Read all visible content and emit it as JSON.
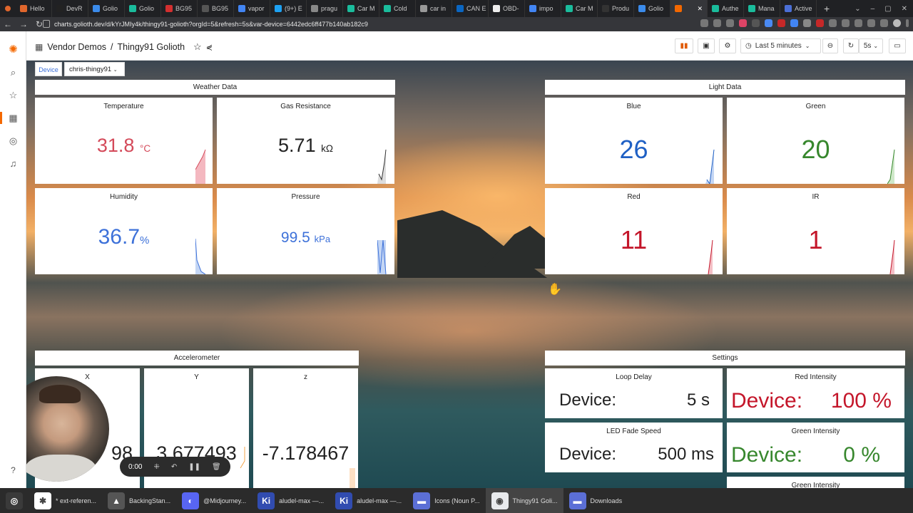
{
  "browser": {
    "tabs": [
      {
        "label": "Hello",
        "color": "#e0662c"
      },
      {
        "label": "DevR",
        "color": "#222"
      },
      {
        "label": "Golio",
        "color": "#3b8beb"
      },
      {
        "label": "Golio",
        "color": "#1abc9c"
      },
      {
        "label": "BG95",
        "color": "#d32f2f"
      },
      {
        "label": "BG95",
        "color": "#555"
      },
      {
        "label": "vapor",
        "color": "#4285f4"
      },
      {
        "label": "(9+) E",
        "color": "#1da1f2"
      },
      {
        "label": "pragu",
        "color": "#888"
      },
      {
        "label": "Car M",
        "color": "#1abc9c"
      },
      {
        "label": "Cold",
        "color": "#1abc9c"
      },
      {
        "label": "car in",
        "color": "#999"
      },
      {
        "label": "CAN E",
        "color": "#0a66c2"
      },
      {
        "label": "OBD-",
        "color": "#eee"
      },
      {
        "label": "impo",
        "color": "#4285f4"
      },
      {
        "label": "Car M",
        "color": "#1abc9c"
      },
      {
        "label": "Produ",
        "color": "#333"
      },
      {
        "label": "Golio",
        "color": "#3b8beb"
      },
      {
        "label": "",
        "color": "#f46800"
      },
      {
        "label": "Authe",
        "color": "#1abc9c"
      },
      {
        "label": "Mana",
        "color": "#1abc9c"
      },
      {
        "label": "Active",
        "color": "#4b6fd6"
      }
    ],
    "url": "charts.golioth.dev/d/kYrJMIy4k/thingy91-golioth?orgId=5&refresh=5s&var-device=6442edc6ff477b140ab182c9"
  },
  "header": {
    "folder": "Vendor Demos",
    "separator": "/",
    "title": "Thingy91 Golioth",
    "time_range": "Last 5 minutes",
    "refresh": "5s"
  },
  "variables": {
    "device_label": "Device",
    "device_value": "chris-thingy91"
  },
  "rows": {
    "weather": "Weather Data",
    "light": "Light Data",
    "accel": "Accelerometer",
    "settings": "Settings"
  },
  "weather": {
    "temperature": {
      "title": "Temperature",
      "value": "31.8",
      "unit": "°C",
      "color": "#d44a5a"
    },
    "gas": {
      "title": "Gas Resistance",
      "value": "5.71",
      "unit": "kΩ",
      "color": "#222"
    },
    "humidity": {
      "title": "Humidity",
      "value": "36.7",
      "unit": "%",
      "color": "#3d71d9"
    },
    "pressure": {
      "title": "Pressure",
      "value": "99.5",
      "unit": "kPa",
      "color": "#3d71d9"
    }
  },
  "light": {
    "blue": {
      "title": "Blue",
      "value": "26",
      "color": "#1f60c4"
    },
    "green": {
      "title": "Green",
      "value": "20",
      "color": "#37872d"
    },
    "red": {
      "title": "Red",
      "value": "11",
      "color": "#c4162a"
    },
    "ir": {
      "title": "IR",
      "value": "1",
      "color": "#c4162a"
    }
  },
  "accel": {
    "x": {
      "title": "X",
      "value": "98"
    },
    "y": {
      "title": "Y",
      "value": "3.677493"
    },
    "z": {
      "title": "z",
      "value": "-7.178467"
    }
  },
  "settings": {
    "loop_delay": {
      "title": "Loop Delay",
      "label": "Device:",
      "value": "5 s",
      "color": "#222"
    },
    "red_intensity": {
      "title": "Red Intensity",
      "label": "Device:",
      "value": "100 %",
      "color": "#c4162a"
    },
    "led_fade": {
      "title": "LED Fade Speed",
      "label": "Device:",
      "value": "500 ms",
      "color": "#222"
    },
    "green_intensity": {
      "title": "Green Intensity",
      "label": "Device:",
      "value": "0 %",
      "color": "#37872d"
    },
    "green_intensity_2": {
      "title": "Green Intensity"
    }
  },
  "recorder": {
    "time": "0:00"
  },
  "taskbar": [
    {
      "label": "",
      "icon": "linux-mint-icon",
      "color": "#3a3a3a",
      "glyph": "◎"
    },
    {
      "label": "* ext-referen...",
      "icon": "slack-icon",
      "color": "#ffffff",
      "glyph": "✱"
    },
    {
      "label": "BackingStan...",
      "icon": "inkscape-icon",
      "color": "#555",
      "glyph": "▲"
    },
    {
      "label": "@Midjourney...",
      "icon": "discord-icon",
      "color": "#5865f2",
      "glyph": "◐"
    },
    {
      "label": "aludel-max —...",
      "icon": "kicad-icon",
      "color": "#314cb0",
      "glyph": "Ki"
    },
    {
      "label": "aludel-max —...",
      "icon": "kicad-icon",
      "color": "#314cb0",
      "glyph": "Ki"
    },
    {
      "label": "Icons (Noun P...",
      "icon": "folder-icon",
      "color": "#5b6fd6",
      "glyph": "▬"
    },
    {
      "label": "Thingy91 Goli...",
      "icon": "chrome-icon",
      "color": "#e8eaed",
      "glyph": "◉"
    },
    {
      "label": "Downloads",
      "icon": "folder-icon",
      "color": "#5b6fd6",
      "glyph": "▬"
    }
  ]
}
